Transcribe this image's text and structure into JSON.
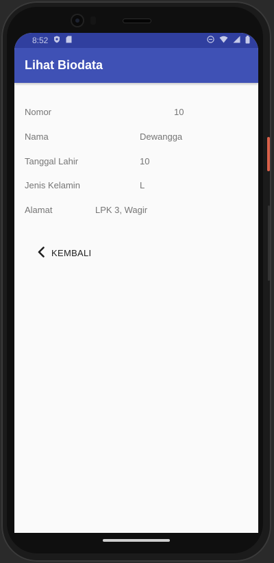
{
  "status_bar": {
    "time": "8:52",
    "background": "#303f9f"
  },
  "app_bar": {
    "title": "Lihat Biodata",
    "background": "#3f51b5"
  },
  "biodata": {
    "nomor": {
      "label": "Nomor",
      "value": "10"
    },
    "nama": {
      "label": "Nama",
      "value": "Dewangga"
    },
    "tanggal_lahir": {
      "label": "Tanggal Lahir",
      "value": "10"
    },
    "jenis_kelamin": {
      "label": "Jenis Kelamin",
      "value": "L"
    },
    "alamat": {
      "label": "Alamat",
      "value": "LPK 3, Wagir"
    }
  },
  "back_button": {
    "label": "KEMBALI",
    "icon": "chevron-left-icon"
  },
  "icons": {
    "status_left": [
      "shield-icon",
      "sd-card-icon"
    ],
    "status_right": [
      "do-not-disturb-icon",
      "wifi-icon",
      "signal-icon",
      "battery-icon"
    ]
  }
}
